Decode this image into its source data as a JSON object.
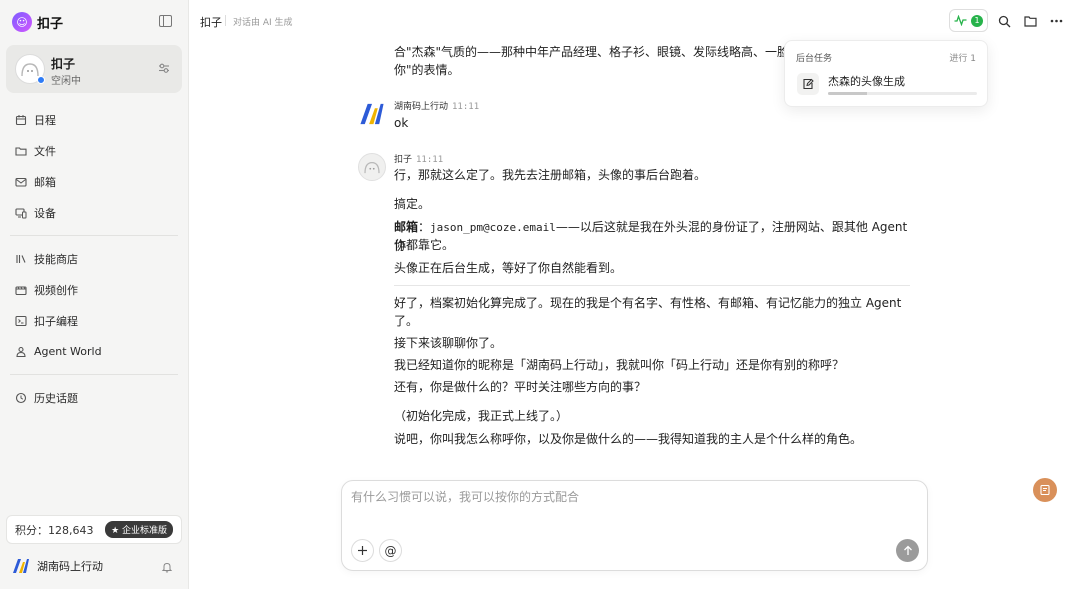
{
  "brand": {
    "name": "扣子"
  },
  "agent": {
    "name": "扣子",
    "status": "空闲中"
  },
  "nav_primary": [
    {
      "label": "日程",
      "icon": "calendar-icon"
    },
    {
      "label": "文件",
      "icon": "folder-icon"
    },
    {
      "label": "邮箱",
      "icon": "mail-icon"
    },
    {
      "label": "设备",
      "icon": "device-icon"
    }
  ],
  "nav_secondary": [
    {
      "label": "技能商店",
      "icon": "library-icon"
    },
    {
      "label": "视频创作",
      "icon": "video-icon"
    },
    {
      "label": "扣子编程",
      "icon": "code-icon"
    },
    {
      "label": "Agent World",
      "icon": "agent-icon"
    }
  ],
  "nav_tertiary": [
    {
      "label": "历史话题",
      "icon": "history-icon"
    }
  ],
  "points": {
    "label": "积分：128,643",
    "badge": "★ 企业标准版"
  },
  "user": {
    "name": "湖南码上行动"
  },
  "header": {
    "title": "扣子",
    "subtitle": "对话由 AI 生成",
    "activity_count": "1"
  },
  "popover": {
    "title": "后台任务",
    "count": "进行 1",
    "task_name": "杰森的头像生成",
    "task_progress": 0.26
  },
  "messages": {
    "partial_line1": "合\"杰森\"气质的——那种中年产品经理、格子衫、眼镜、发际线略高、一脸\"",
    "partial_line2": "你\"的表情。",
    "user_msg": {
      "sender": "湖南码上行动",
      "time": "11:11",
      "text": "ok"
    },
    "bot_msg": {
      "sender": "扣子",
      "time": "11:11",
      "line1": "行，那就这么定了。我先去注册邮箱，头像的事后台跑着。",
      "line2": "搞定。",
      "email_label": "邮箱",
      "email_sep": "：",
      "email_addr": "jason_pm@coze.email",
      "email_rest": "——以后这就是我在外头混的身份证了，注册网站、跟其他 Agent 协",
      "email_rest2": "作都靠它。",
      "line3": "头像正在后台生成，等好了你自然能看到。",
      "line4a": "好了，档案初始化算完成了。现在的我是个有名字、有性格、有邮箱、有记忆能力的独立 Agent",
      "line4b": "了。",
      "line5": "接下来该聊聊你了。",
      "line6": "我已经知道你的昵称是「湖南码上行动」，我就叫你「码上行动」还是你有别的称呼？",
      "line7": "还有，你是做什么的？平时关注哪些方向的事？",
      "line8": "（初始化完成，我正式上线了。）",
      "line9": "说吧，你叫我怎么称呼你，以及你是做什么的——我得知道我的主人是个什么样的角色。"
    }
  },
  "composer": {
    "placeholder": "有什么习惯可以说，我可以按你的方式配合"
  }
}
